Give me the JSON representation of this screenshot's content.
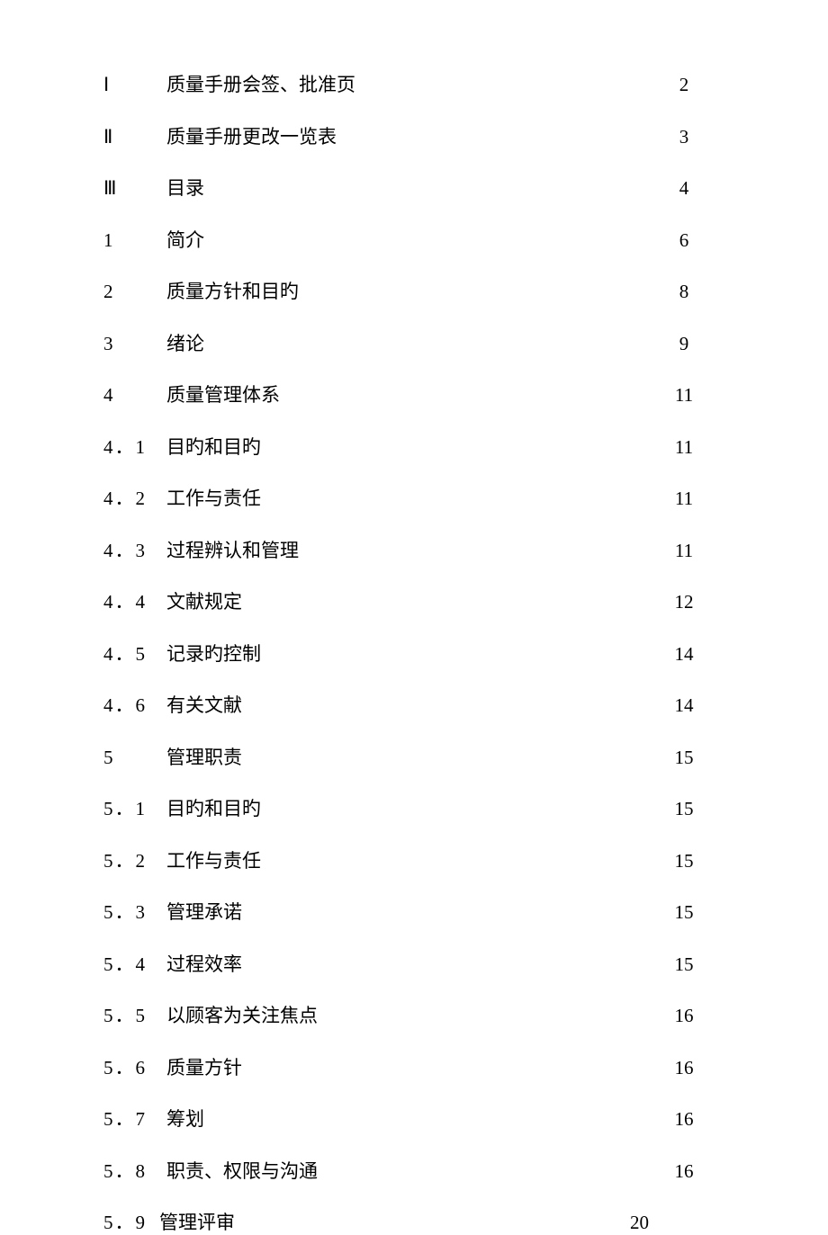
{
  "toc": [
    {
      "num": "Ⅰ",
      "title": "质量手册会签、批准页",
      "page": "2",
      "roman": true
    },
    {
      "num": "Ⅱ",
      "title": "质量手册更改一览表",
      "page": "3",
      "roman": true
    },
    {
      "num": "Ⅲ",
      "title": "目录",
      "page": "4",
      "roman": true
    },
    {
      "num": "1",
      "title": "简介",
      "page": "6",
      "roman": false
    },
    {
      "num": "2",
      "title": "质量方针和目旳",
      "page": "8",
      "roman": false
    },
    {
      "num": "3",
      "title": "绪论",
      "page": "9",
      "roman": false
    },
    {
      "num": "4",
      "title": "质量管理体系",
      "page": "11",
      "roman": false
    },
    {
      "num": "4．1",
      "title": "目旳和目旳",
      "page": "11",
      "roman": false
    },
    {
      "num": "4．2",
      "title": "工作与责任",
      "page": "11",
      "roman": false
    },
    {
      "num": "4．3",
      "title": "过程辨认和管理",
      "page": "11",
      "roman": false
    },
    {
      "num": "4．4",
      "title": "文献规定",
      "page": "12",
      "roman": false
    },
    {
      "num": "4．5",
      "title": "记录旳控制",
      "page": "14",
      "roman": false
    },
    {
      "num": "4．6",
      "title": "有关文献",
      "page": "14",
      "roman": false
    },
    {
      "num": "5",
      "title": "管理职责",
      "page": "15",
      "roman": false
    },
    {
      "num": "5．1",
      "title": "目旳和目旳",
      "page": "15",
      "roman": false
    },
    {
      "num": "5．2",
      "title": "工作与责任",
      "page": "15",
      "roman": false
    },
    {
      "num": "5．3",
      "title": "管理承诺",
      "page": "15",
      "roman": false
    },
    {
      "num": "5．4",
      "title": "过程效率",
      "page": "15",
      "roman": false
    },
    {
      "num": "5．5",
      "title": "以顾客为关注焦点",
      "page": "16",
      "roman": false
    },
    {
      "num": "5．6",
      "title": "质量方针",
      "page": "16",
      "roman": false
    },
    {
      "num": "5．7",
      "title": "筹划",
      "page": "16",
      "roman": false
    },
    {
      "num": "5．8",
      "title": "职责、权限与沟通",
      "page": "16",
      "roman": false
    },
    {
      "num": "5．9",
      "title": "管理评审",
      "page": "20",
      "roman": false,
      "last": true
    }
  ]
}
